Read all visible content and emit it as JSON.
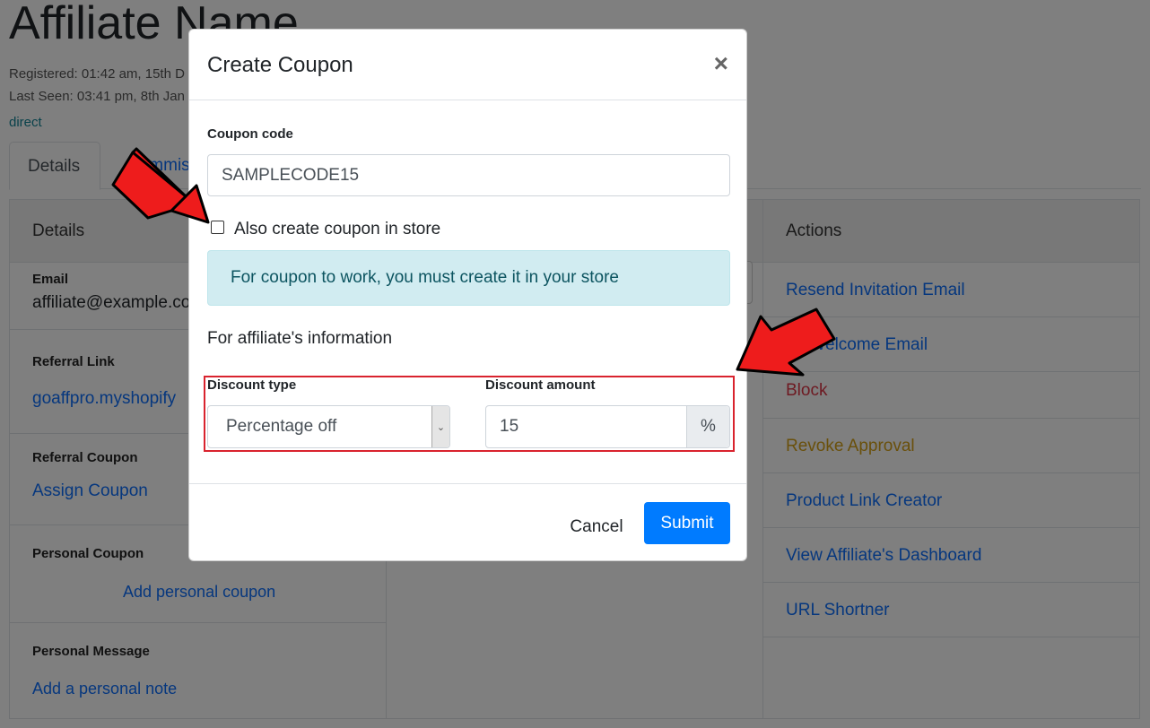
{
  "page": {
    "title": "Affiliate Name",
    "registered": "Registered: 01:42 am, 15th D",
    "last_seen": "Last Seen: 03:41 pm, 8th Jan",
    "source": "direct"
  },
  "tabs": [
    "Details",
    "Commiss",
    "s"
  ],
  "details_card": {
    "header": "Details",
    "email_label": "Email",
    "email_value": "affiliate@example.co",
    "referral_link_label": "Referral Link",
    "referral_link_value": "goaffpro.myshopify",
    "referral_coupon_label": "Referral Coupon",
    "referral_coupon_link": "Assign Coupon",
    "personal_coupon_label": "Personal Coupon",
    "personal_coupon_link": "Add personal coupon",
    "personal_message_label": "Personal Message",
    "personal_message_link": "Add a personal note"
  },
  "actions_card": {
    "header": "Actions",
    "items": [
      {
        "label": "Resend Invitation Email",
        "color": "#0d6efd"
      },
      {
        "label": "nd Welcome Email",
        "color": "#0d6efd"
      },
      {
        "label": "Block",
        "color": "#dc3545"
      },
      {
        "label": "Revoke Approval",
        "color": "#d4a017"
      },
      {
        "label": "Product Link Creator",
        "color": "#0d6efd"
      },
      {
        "label": "View Affiliate's Dashboard",
        "color": "#0d6efd"
      },
      {
        "label": "URL Shortner",
        "color": "#0d6efd"
      }
    ]
  },
  "modal": {
    "title": "Create Coupon",
    "close_icon": "×",
    "coupon_code_label": "Coupon code",
    "coupon_code_value": "SAMPLECODE15",
    "checkbox_label": "Also create coupon in store",
    "checkbox_checked": false,
    "alert_text": "For coupon to work, you must create it in your store",
    "info_text": "For affiliate's information",
    "discount_type_label": "Discount type",
    "discount_type_value": "Percentage off",
    "discount_amount_label": "Discount amount",
    "discount_amount_value": "15",
    "discount_amount_unit": "%",
    "cancel_label": "Cancel",
    "submit_label": "Submit"
  },
  "colors": {
    "accent": "#007bff",
    "alert_bg": "#d1ecf1",
    "highlight_border": "#d9232e",
    "arrow": "#ee1c1c"
  }
}
